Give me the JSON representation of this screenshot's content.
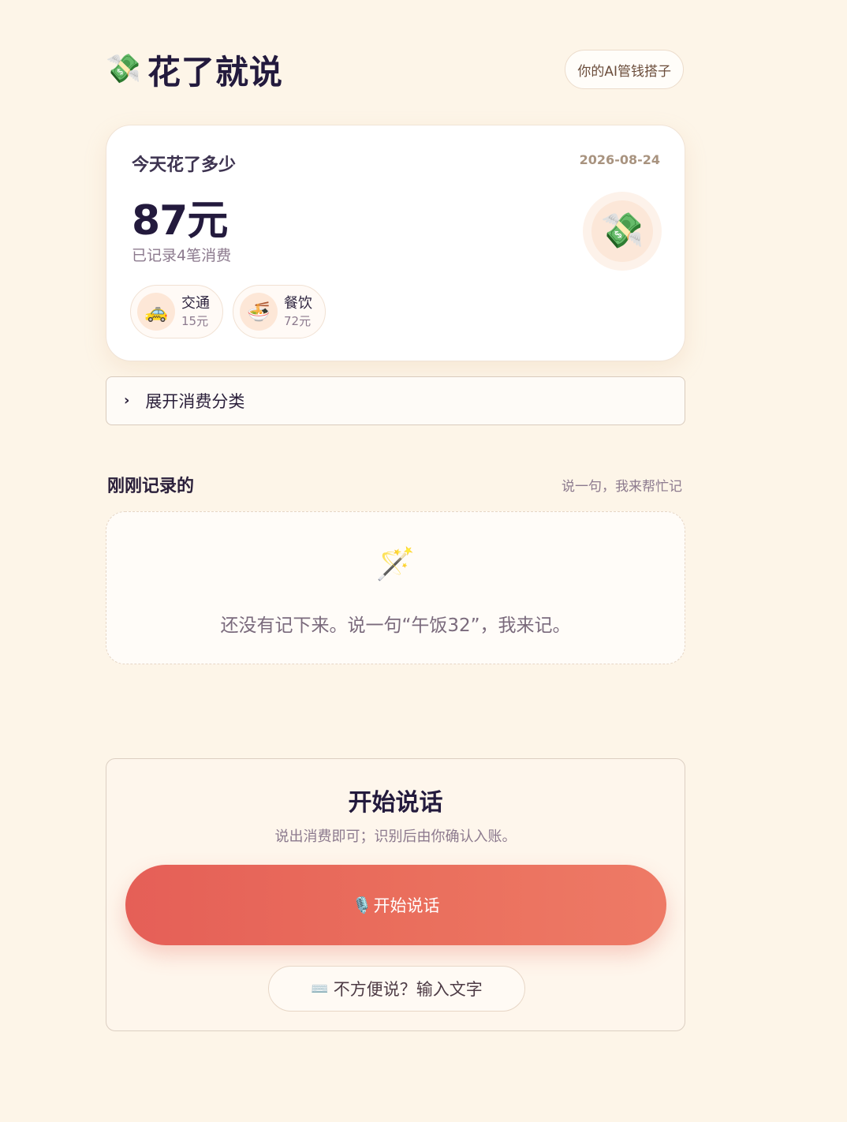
{
  "header": {
    "logo_icon": "money-with-wings-icon",
    "logo_glyph": "💸",
    "title": "花了就说",
    "tag": "你的AI管钱搭子"
  },
  "today": {
    "label": "今天花了多少",
    "date": "2026-08-24",
    "amount": "87元",
    "count_text": "已记录4笔消费",
    "badge_glyph": "💸",
    "categories": [
      {
        "icon": "taxi-icon",
        "glyph": "🚕",
        "name": "交通",
        "amount": "15元"
      },
      {
        "icon": "noodle-bowl-icon",
        "glyph": "🍜",
        "name": "餐饮",
        "amount": "72元"
      }
    ]
  },
  "expand": {
    "chevron": "›",
    "label": "展开消费分类"
  },
  "recent": {
    "title": "刚刚记录的",
    "hint": "说一句，我来帮忙记",
    "empty_glyph": "🪄",
    "empty_text": "还没有记下来。说一句“午饭32”，我来记。"
  },
  "voice": {
    "title": "开始说话",
    "subtitle": "说出消费即可；识别后由你确认入账。",
    "record_glyph": "🎙️",
    "record_label": "开始说话",
    "text_glyph": "⌨️",
    "text_label": "不方便说？输入文字"
  },
  "colors": {
    "background": "#fdf5e8",
    "primary_gradient_start": "#e55f57",
    "primary_gradient_end": "#ee7a66",
    "title_text": "#231a3d"
  }
}
